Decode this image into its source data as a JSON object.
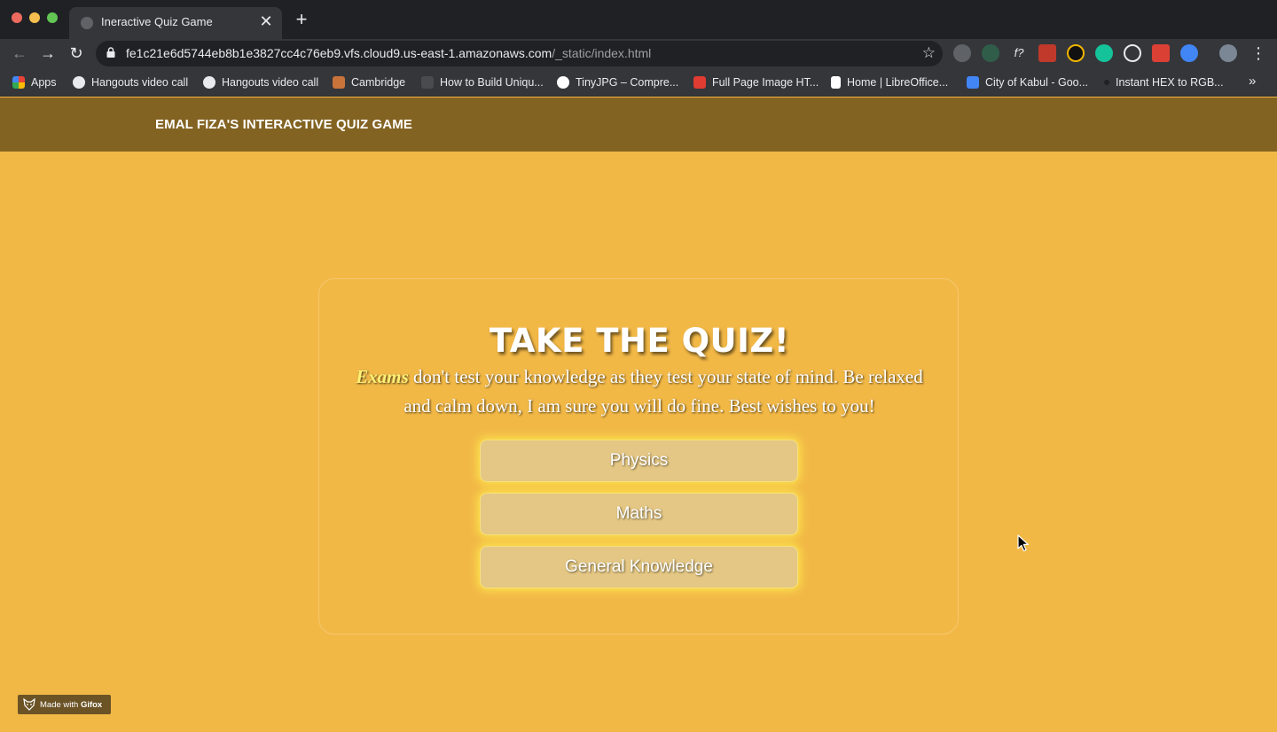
{
  "browser": {
    "tab_title": "Ineractive Quiz Game",
    "tab_close": "✕",
    "new_tab": "+",
    "url_host": "fe1c21e6d5744eb8b1e3827cc4c76eb9.vfs.cloud9.us-east-1.amazonaws.com",
    "url_path": "/_static/index.html",
    "star_icon": "☆",
    "menu_icon": "⋮",
    "nav": {
      "back": "←",
      "forward": "→",
      "reload": "↻"
    },
    "bookmarks": [
      {
        "label": "Apps",
        "icon": "apps-grid-icon",
        "color": "#4285f4"
      },
      {
        "label": "Hangouts video call",
        "icon": "globe-icon",
        "color": "#e8eaed"
      },
      {
        "label": "Hangouts video call",
        "icon": "globe-icon",
        "color": "#e8eaed"
      },
      {
        "label": "Cambridge",
        "icon": "cambridge-crest-icon",
        "color": "#c9733b"
      },
      {
        "label": "How to Build Uniqu...",
        "icon": "bolt-icon",
        "color": "#5f6368"
      },
      {
        "label": "TinyJPG – Compre...",
        "icon": "panda-icon",
        "color": "#ffffff"
      },
      {
        "label": "Full Page Image HT...",
        "icon": "s-logo-icon",
        "color": "#e03c31"
      },
      {
        "label": "Home | LibreOffice...",
        "icon": "document-icon",
        "color": "#ffffff"
      },
      {
        "label": "City of Kabul - Goo...",
        "icon": "google-docs-icon",
        "color": "#4285f4"
      },
      {
        "label": "Instant HEX to RGB...",
        "icon": "dot-icon",
        "color": "#202124"
      }
    ],
    "bookmarks_more": "»"
  },
  "page": {
    "site_title": "EMAL FIZA'S INTERACTIVE QUIZ GAME",
    "heading": "TAKE THE QUIZ!",
    "intro_emphasis": "Exams",
    "intro_text": " don't test your knowledge as they test your state of mind. Be relaxed and calm down, I am sure you will do fine. Best wishes to you!",
    "subjects": [
      "Physics",
      "Maths",
      "General Knowledge"
    ]
  },
  "watermark": {
    "text_prefix": "Made with ",
    "text_brand": "Gifox"
  },
  "colors": {
    "page_background": "#f2b846",
    "header_background": "#836322",
    "button_background": "#e4c784",
    "button_glow": "#ffee50",
    "emphasis_text": "#fff176"
  }
}
